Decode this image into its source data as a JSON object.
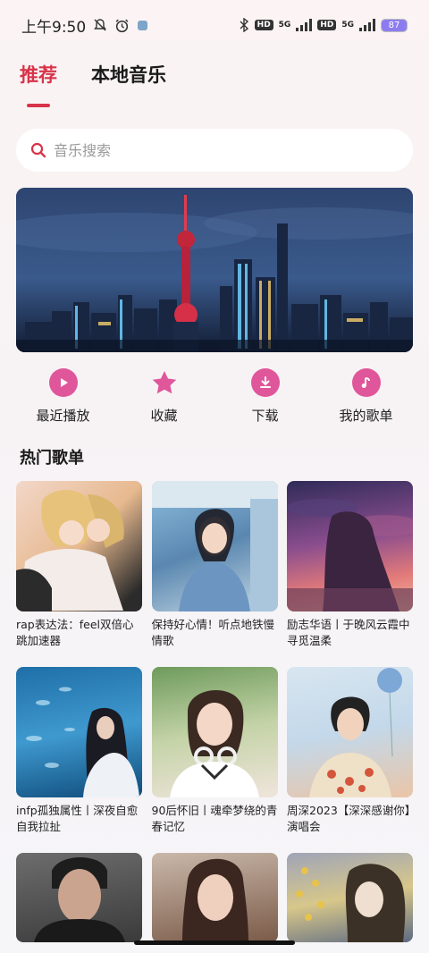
{
  "status_bar": {
    "time": "上午9:50",
    "network_5g_a": "5G",
    "network_5g_b": "5G",
    "hd_a": "HD",
    "hd_b": "HD",
    "battery": "87"
  },
  "tabs": [
    {
      "label": "推荐",
      "active": true
    },
    {
      "label": "本地音乐",
      "active": false
    }
  ],
  "search": {
    "placeholder": "音乐搜索"
  },
  "quick_actions": [
    {
      "label": "最近播放",
      "icon": "play-icon"
    },
    {
      "label": "收藏",
      "icon": "star-icon"
    },
    {
      "label": "下载",
      "icon": "download-icon"
    },
    {
      "label": "我的歌单",
      "icon": "music-note-icon"
    }
  ],
  "section": {
    "title": "热门歌单"
  },
  "playlists": [
    {
      "title": "rap表达法：feel双倍心跳加速器"
    },
    {
      "title": "保持好心情！听点地铁慢情歌"
    },
    {
      "title": "励志华语丨于晚风云霞中寻觅温柔"
    },
    {
      "title": "infp孤独属性丨深夜自愈自我拉扯"
    },
    {
      "title": "90后怀旧丨魂牵梦绕的青春记忆"
    },
    {
      "title": "周深2023【深深感谢你】演唱会"
    },
    {
      "title": ""
    },
    {
      "title": ""
    },
    {
      "title": ""
    }
  ],
  "colors": {
    "accent": "#d8344a",
    "icon_pink": "#e0569b",
    "background": "#f7f3f5"
  }
}
